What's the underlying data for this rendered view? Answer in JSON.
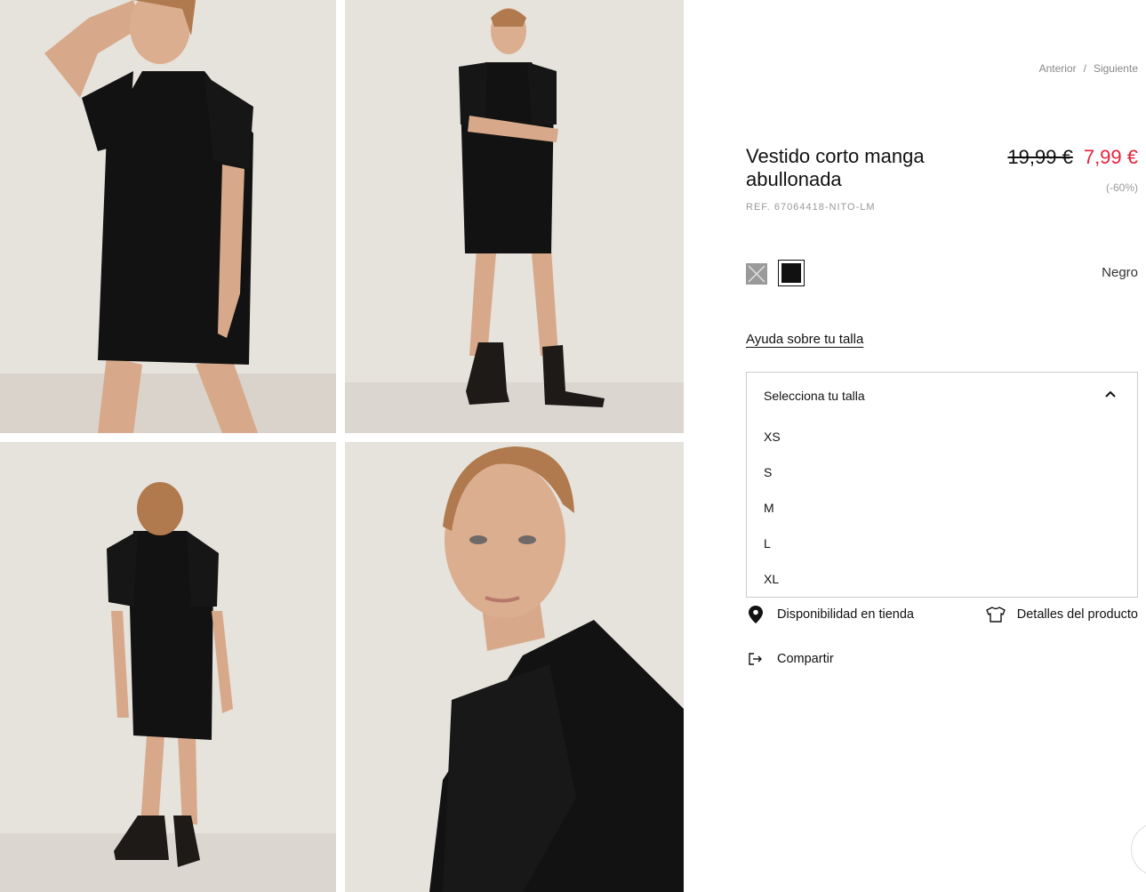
{
  "nav": {
    "previous": "Anterior",
    "separator": "/",
    "next": "Siguiente"
  },
  "product": {
    "title": "Vestido corto manga abullonada",
    "ref": "REF. 67064418-NITO-LM",
    "old_price": "19,99 €",
    "new_price": "7,99 €",
    "discount": "(-60%)",
    "price_color": "#e8223a"
  },
  "colors": {
    "selected_name": "Negro",
    "swatches": [
      {
        "name": "grey",
        "hex": "#9a9a9a",
        "available": false
      },
      {
        "name": "black",
        "hex": "#111111",
        "available": true,
        "selected": true
      }
    ]
  },
  "size": {
    "help_label": "Ayuda sobre tu talla",
    "select_placeholder": "Selecciona tu talla",
    "options": [
      "XS",
      "S",
      "M",
      "L",
      "XL"
    ]
  },
  "actions": {
    "store_availability": "Disponibilidad en tienda",
    "product_details": "Detalles del producto",
    "share": "Compartir"
  },
  "gallery": {
    "images": [
      "front-pose-hand-on-head",
      "front-arms-crossed",
      "back-view",
      "portrait-closeup"
    ]
  }
}
